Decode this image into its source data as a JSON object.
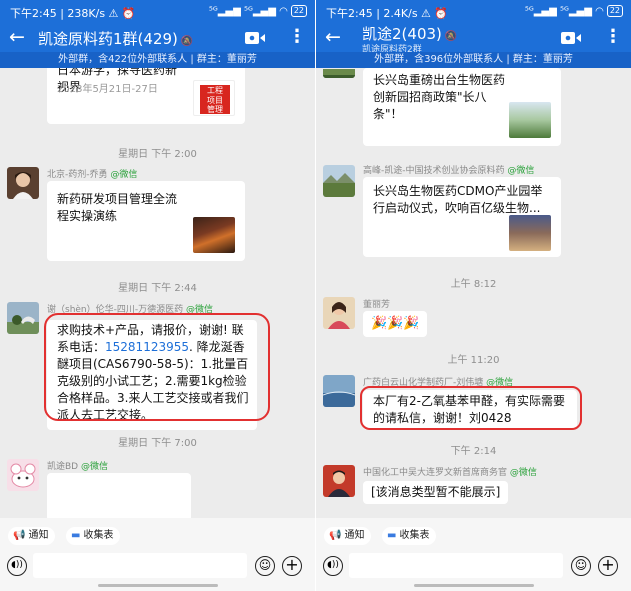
{
  "left": {
    "status": {
      "time_speed": "下午2:45 | 238K/s ⚠ ⏰",
      "signal": "⁵ᴳ▂▄▆ ⁵ᴳ▂▄▆ ◠",
      "battery": "22"
    },
    "header": {
      "title": "凯途原料药1群(429)",
      "mute_icon": "🔕",
      "notice": "外部群，含422位外部联系人 | 群主：董丽芳"
    },
    "card1": {
      "text": "日本游学，探寻医药新视界",
      "date": "2023年5月21日-27日",
      "thumb_text": "工程\n项目\n管理",
      "thumb_color": "#d8261f"
    },
    "sep1": "星期日 下午 2:00",
    "msg1": {
      "sender": "北京-药剂-乔勇",
      "tag": "@微信",
      "card_text": "新药研发项目管理全流程实操演练"
    },
    "sep2": "星期日 下午 2:44",
    "msg2": {
      "sender": "谢（shèn）伦华-四川-万德源医药",
      "tag": "@微信",
      "line1": "求购技术+产品，请报价，谢谢! 联系电话：",
      "phone": "15281123955",
      "line2": ". 降龙涎香醚项目(CAS6790-58-5)：1.批量百克级别的小试工艺；2.需要1kg检验合格样品。3.来人工艺交接或者我们派人去工艺交接。"
    },
    "sep3": "星期日 下午 7:00",
    "msg3": {
      "sender": "凯途BD",
      "tag": "@微信"
    },
    "chips": {
      "notice": "通知",
      "collect": "收集表"
    }
  },
  "right": {
    "status": {
      "time_speed": "下午2:45 | 2.4K/s ⚠ ⏰",
      "signal": "⁵ᴳ▂▄▆ ⁵ᴳ▂▄▆ ◠",
      "battery": "22"
    },
    "header": {
      "title": "凯途2(403)",
      "mute_icon": "🔕",
      "subtitle": "凯途原料药2群",
      "notice": "外部群，含396位外部联系人 | 群主：董丽芳"
    },
    "card1": {
      "text": "长兴岛重磅出台生物医药创新园招商政策\"长八条\"！"
    },
    "msg1": {
      "sender": "高峰-凯途-中国技术创业协会原料药",
      "tag": "@微信",
      "card_text": "长兴岛生物医药CDMO产业园举行启动仪式，吹响百亿级生物..."
    },
    "sep1": "上午 8:12",
    "msg2": {
      "sender": "董丽芳",
      "emojis": "🎉🎉🎉"
    },
    "sep2": "上午 11:20",
    "msg3": {
      "sender": "广药白云山化学制药厂-刘伟塘",
      "tag": "@微信",
      "text": "本厂有2-乙氧基苯甲醛，有实际需要的请私信，谢谢！刘0428"
    },
    "sep3": "下午 2:14",
    "msg4": {
      "sender": "中国化工中吴大连罗文新首席商务官",
      "tag": "@微信",
      "text": "[该消息类型暂不能展示]"
    },
    "chips": {
      "notice": "通知",
      "collect": "收集表"
    }
  },
  "colors": {
    "header_blue": "#1d6fd8",
    "notice_blue": "#1862c7",
    "highlight_red": "#e23030",
    "wechat_green": "#2aa13a"
  }
}
